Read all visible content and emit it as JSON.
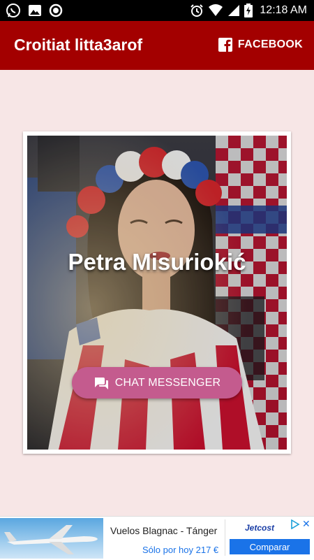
{
  "status_bar": {
    "time": "12:18 AM",
    "icons": [
      "whatsapp-icon",
      "image-icon",
      "record-icon",
      "alarm-icon",
      "wifi-icon",
      "signal-icon",
      "battery-charging-icon"
    ]
  },
  "app_bar": {
    "title": "Croitiat litta3arof",
    "facebook_label": "FACEBOOK",
    "facebook_icon": "facebook-icon",
    "color": "#a30000"
  },
  "profile_card": {
    "name": "Petra Misuriokić",
    "chat_button_label": "CHAT MESSENGER",
    "chat_icon": "chat-bubbles-icon",
    "button_color": "#c45b8e"
  },
  "ad": {
    "title": "Vuelos Blagnac - Tánger",
    "subtitle": "Sólo por hoy 217 €",
    "brand": "Jetcost",
    "cta_label": "Comparar",
    "close_label": "✕",
    "choices_icon": "adchoices-icon"
  }
}
